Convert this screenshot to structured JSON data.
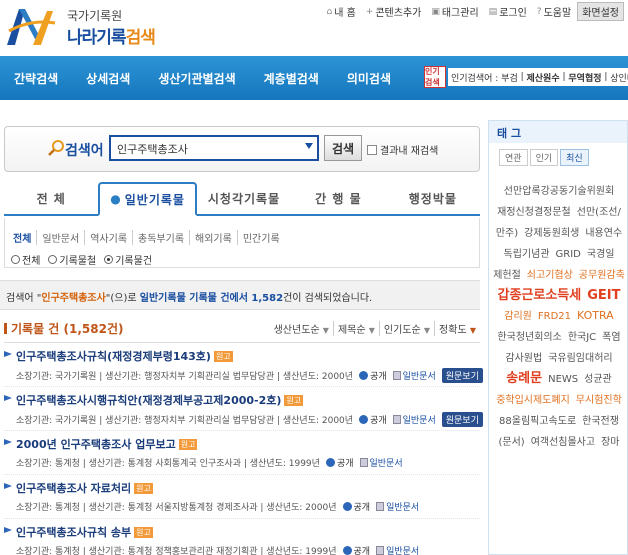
{
  "header": {
    "logo_sub": "국가기록원",
    "logo_main_a": "나라기록",
    "logo_main_b": "검색",
    "util_links": [
      "내 홈",
      "콘텐츠추가",
      "태그관리",
      "로그인",
      "도움말"
    ],
    "screen_setting": "화면설정"
  },
  "nav": {
    "items": [
      "간략검색",
      "상세검색",
      "생산기관별검색",
      "계층별검색",
      "의미검색"
    ],
    "ticker_icon": "인기검색",
    "ticker_label": "인기검색어 :",
    "ticker_words": [
      "부검",
      "제산원수",
      "무역협정",
      "상인대"
    ]
  },
  "search": {
    "label": "검색어 :",
    "value": "인구주택총조사",
    "button": "검색",
    "re_search": "결과내 재검색"
  },
  "main_tabs": [
    "전  체",
    "일반기록물",
    "시청각기록물",
    "간 행 물",
    "행정박물"
  ],
  "sub_tabs": [
    "전체",
    "일반문서",
    "역사기록",
    "총독부기록",
    "해외기록",
    "민간기록"
  ],
  "radios": [
    {
      "label": "전체",
      "on": false
    },
    {
      "label": "기록물철",
      "on": false
    },
    {
      "label": "기록물건",
      "on": true
    }
  ],
  "summary": {
    "p1": "검색어 \"",
    "keyword": "인구주택총조사",
    "p2": "\"(으)로 ",
    "category": "일반기록물 기록물 건에서 1,582",
    "p3": "건이 검색되었습니다."
  },
  "list_title": "기록물 건 (1,582건)",
  "sorts": [
    "생산년도순",
    "제목순",
    "인기도순",
    "정확도"
  ],
  "items": [
    {
      "title": "인구주택총조사규칙(재정경제부령143호)",
      "badge": "원고",
      "meta": "소장기관: 국가기록원 | 생산기관: 행정자치부 기획관리실 법무담당관 | 생산년도: 2000년",
      "public": "공개",
      "doc": "일반문서",
      "view": "원문보기"
    },
    {
      "title": "인구주택총조사시행규칙안(재정경제부공고제2000-2호)",
      "badge": "원고",
      "meta": "소장기관: 국가기록원 | 생산기관: 행정자치부 기획관리실 법무담당관 | 생산년도: 2000년",
      "public": "공개",
      "doc": "일반문서",
      "view": "원문보기"
    },
    {
      "title": "2000년 인구주택총조사 업무보고",
      "badge": "원고",
      "meta": "소장기관: 통계청 | 생산기관: 통계청 사회통계국 인구조사과 | 생산년도: 1999년",
      "public": "공개",
      "doc": "일반문서",
      "view": ""
    },
    {
      "title": "인구주택총조사 자료처리",
      "badge": "원고",
      "meta": "소장기관: 통계청 | 생산기관: 통계청 서울지방통계청 경제조사과 | 생산년도: 2000년",
      "public": "공개",
      "doc": "일반문서",
      "view": ""
    },
    {
      "title": "인구주택총조사규칙 송부",
      "badge": "원고",
      "meta": "소장기관: 통계청 | 생산기관: 통계청 정책홍보관리관 재정기획관 | 생산년도: 1999년",
      "public": "공개",
      "doc": "일반문서",
      "view": ""
    }
  ],
  "tags": {
    "title": "태 그",
    "tabs": [
      "연관",
      "인기",
      "최신"
    ],
    "words": [
      {
        "t": "선만압록강공동기술위원회",
        "s": 10,
        "c": "#555"
      },
      {
        "t": "재정신청결정문철",
        "s": 10,
        "c": "#555"
      },
      {
        "t": "선만(조선/",
        "s": 10,
        "c": "#555"
      },
      {
        "t": "만주)",
        "s": 10,
        "c": "#555"
      },
      {
        "t": "강제동원희생",
        "s": 10,
        "c": "#555"
      },
      {
        "t": "내용연수",
        "s": 10,
        "c": "#555"
      },
      {
        "t": "독립기념관",
        "s": 10,
        "c": "#555"
      },
      {
        "t": "GRID",
        "s": 10,
        "c": "#555"
      },
      {
        "t": "국경일",
        "s": 10,
        "c": "#555"
      },
      {
        "t": "제헌절",
        "s": 10,
        "c": "#555"
      },
      {
        "t": "쇠고기협상",
        "s": 10,
        "c": "#e07020"
      },
      {
        "t": "공무원감축",
        "s": 10,
        "c": "#e07020"
      },
      {
        "t": "갑종근로소득세",
        "s": 13,
        "c": "#e04020"
      },
      {
        "t": "GEIT",
        "s": 13,
        "c": "#e04020"
      },
      {
        "t": "감리원",
        "s": 10,
        "c": "#e07020"
      },
      {
        "t": "FRD21",
        "s": 10,
        "c": "#e07020"
      },
      {
        "t": "KOTRA",
        "s": 11,
        "c": "#e07020"
      },
      {
        "t": "한국청년회의소",
        "s": 10,
        "c": "#555"
      },
      {
        "t": "한국JC",
        "s": 10,
        "c": "#555"
      },
      {
        "t": "폭염",
        "s": 10,
        "c": "#555"
      },
      {
        "t": "감사원법",
        "s": 10,
        "c": "#555"
      },
      {
        "t": "국유림임대허리",
        "s": 10,
        "c": "#555"
      },
      {
        "t": "송례문",
        "s": 13,
        "c": "#e04020"
      },
      {
        "t": "NEWS",
        "s": 10,
        "c": "#555"
      },
      {
        "t": "성균관",
        "s": 10,
        "c": "#555"
      },
      {
        "t": "중학입시제도폐지",
        "s": 10,
        "c": "#e07020"
      },
      {
        "t": "무시험진학",
        "s": 10,
        "c": "#e07020"
      },
      {
        "t": "88올림픽고속도로",
        "s": 10,
        "c": "#555"
      },
      {
        "t": "한국전쟁",
        "s": 10,
        "c": "#555"
      },
      {
        "t": "(문서)",
        "s": 10,
        "c": "#555"
      },
      {
        "t": "여객선침몰사고",
        "s": 10,
        "c": "#555"
      },
      {
        "t": "장마",
        "s": 10,
        "c": "#555"
      }
    ]
  }
}
